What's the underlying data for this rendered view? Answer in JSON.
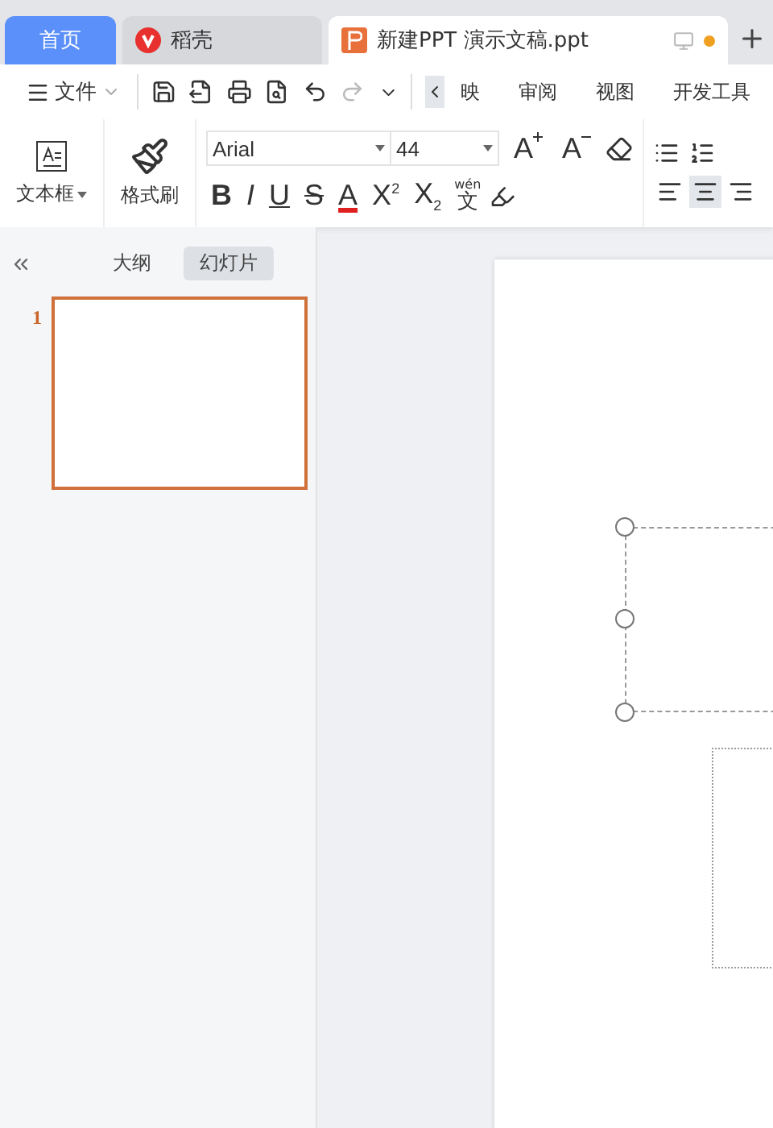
{
  "tabs": [
    {
      "label": "首页",
      "kind": "home",
      "selected": false
    },
    {
      "label": "稻壳",
      "kind": "docer",
      "selected": false
    },
    {
      "label": "新建PPT 演示文稿.ppt",
      "kind": "doc",
      "selected": true,
      "unsaved": true
    }
  ],
  "menu": {
    "label": "文件"
  },
  "ribbon_tabs": [
    {
      "label": "映",
      "selected": false
    },
    {
      "label": "审阅",
      "selected": false
    },
    {
      "label": "视图",
      "selected": false
    },
    {
      "label": "开发工具",
      "selected": false
    }
  ],
  "ribbon": {
    "textbox": {
      "label": "文本框"
    },
    "format_painter": {
      "label": "格式刷"
    },
    "font": {
      "value": "Arial"
    },
    "size": {
      "value": "44"
    },
    "grow": "A",
    "shrink": "A",
    "styles": [
      {
        "label": "B",
        "kind": "bold"
      },
      {
        "label": "I",
        "kind": "italic"
      },
      {
        "label": "U",
        "kind": "underline"
      },
      {
        "label": "S",
        "kind": "strike"
      }
    ],
    "font_color": {
      "label": "A",
      "color": "#e02020"
    },
    "scripts": [
      {
        "base": "X",
        "mark": "2",
        "kind": "sup"
      },
      {
        "base": "X",
        "mark": "2",
        "kind": "sub"
      }
    ],
    "pinyin": {
      "ruby": "wén",
      "char": "文"
    },
    "align": [
      {
        "kind": "left",
        "selected": false
      },
      {
        "kind": "center",
        "selected": true
      },
      {
        "kind": "right",
        "selected": false
      }
    ]
  },
  "side": {
    "tabs": [
      {
        "label": "大纲",
        "selected": false
      },
      {
        "label": "幻灯片",
        "selected": true
      }
    ],
    "slides": [
      {
        "number": "1",
        "selected": true
      }
    ]
  }
}
